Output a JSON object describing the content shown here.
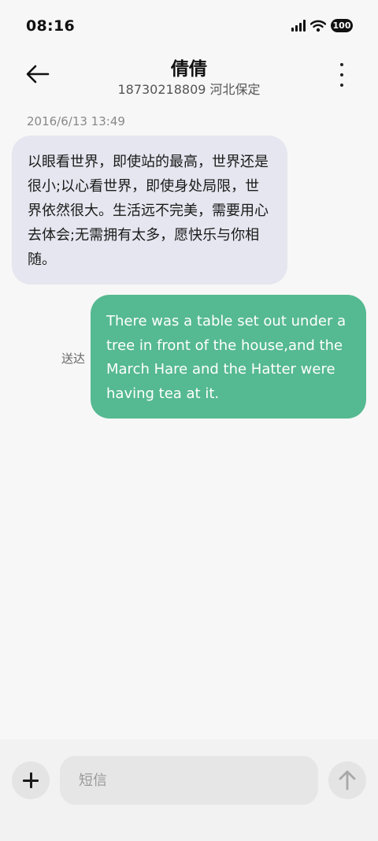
{
  "status_bar": {
    "time": "08:16",
    "battery": "100",
    "icons": [
      "signal-icon",
      "wifi-icon",
      "battery-icon"
    ]
  },
  "header": {
    "title": "倩倩",
    "subtitle": "18730218809 河北保定"
  },
  "conversation": {
    "timestamp": "2016/6/13 13:49",
    "messages": [
      {
        "direction": "incoming",
        "text": "以眼看世界，即使站的最高，世界还是很小;以心看世界，即使身处局限，世界依然很大。生活远不完美，需要用心去体会;无需拥有太多，愿快乐与你相随。"
      },
      {
        "direction": "outgoing",
        "text": "There was a table set out under a tree in front of the house,and the March Hare and the Hatter were having tea at it.",
        "status": "送达"
      }
    ]
  },
  "composer": {
    "placeholder": "短信",
    "value": ""
  },
  "colors": {
    "background": "#f7f7f7",
    "incoming_bubble": "#e6e6f0",
    "outgoing_bubble": "#55b991",
    "input_bar": "#f2f2f2"
  }
}
